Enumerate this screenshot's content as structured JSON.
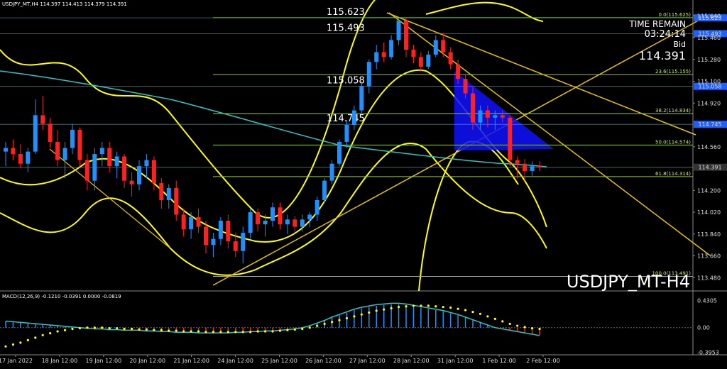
{
  "header": {
    "symbol_line": "USDJPY_MT,H4  114.397 114.413 114.379 114.391",
    "macd_line": "MACD(12,26,9) -0.1210 -0.0391 0.0000 -0.0819"
  },
  "info": {
    "time_remain_label": "TIME REMAIN",
    "time_remain_value": "03:24:14",
    "bid_label": "Bid",
    "bid_value": "114.391",
    "watermark": "USDJPY_MT-H4"
  },
  "colors": {
    "background": "#000000",
    "bull": "#1e90ff",
    "bear": "#ff2020",
    "bands": "#ffff00",
    "ma": "#2ec4c4",
    "fib": "#90c83c",
    "trend": "#e6c200",
    "triangle": "#1010ff",
    "macd_signal": "#ffff00"
  },
  "chart_data": {
    "type": "candlestick",
    "price_axis": {
      "ylim": [
        113.4,
        115.7
      ],
      "ticks": [
        "115.640",
        "115.460",
        "115.280",
        "115.100",
        "114.920",
        "114.560",
        "114.200",
        "114.020",
        "113.840",
        "113.660",
        "113.480"
      ]
    },
    "time_axis": {
      "ticks": [
        "17 Jan 2022",
        "18 Jan 12:00",
        "19 Jan 12:00",
        "20 Jan 12:00",
        "21 Jan 12:00",
        "24 Jan 12:00",
        "25 Jan 12:00",
        "26 Jan 12:00",
        "27 Jan 12:00",
        "28 Jan 12:00",
        "31 Jan 12:00",
        "1 Feb 12:00",
        "2 Feb 12:00"
      ]
    },
    "candles": [
      [
        114.52,
        114.6,
        114.4,
        114.55
      ],
      [
        114.55,
        114.62,
        114.45,
        114.5
      ],
      [
        114.5,
        114.58,
        114.38,
        114.42
      ],
      [
        114.42,
        114.55,
        114.35,
        114.52
      ],
      [
        114.52,
        114.95,
        114.5,
        114.82
      ],
      [
        114.82,
        114.98,
        114.7,
        114.75
      ],
      [
        114.75,
        114.8,
        114.55,
        114.6
      ],
      [
        114.6,
        114.7,
        114.4,
        114.45
      ],
      [
        114.45,
        114.6,
        114.3,
        114.55
      ],
      [
        114.55,
        114.75,
        114.5,
        114.7
      ],
      [
        114.7,
        114.72,
        114.4,
        114.45
      ],
      [
        114.45,
        114.5,
        114.2,
        114.28
      ],
      [
        114.28,
        114.55,
        114.2,
        114.5
      ],
      [
        114.5,
        114.6,
        114.4,
        114.55
      ],
      [
        114.55,
        114.6,
        114.35,
        114.4
      ],
      [
        114.4,
        114.52,
        114.3,
        114.48
      ],
      [
        114.48,
        114.5,
        114.22,
        114.28
      ],
      [
        114.28,
        114.35,
        114.15,
        114.25
      ],
      [
        114.25,
        114.45,
        114.2,
        114.4
      ],
      [
        114.4,
        114.5,
        114.3,
        114.45
      ],
      [
        114.45,
        114.48,
        114.2,
        114.26
      ],
      [
        114.26,
        114.3,
        114.05,
        114.12
      ],
      [
        114.12,
        114.25,
        114.05,
        114.22
      ],
      [
        114.22,
        114.28,
        113.95,
        114.0
      ],
      [
        114.0,
        114.05,
        113.82,
        113.88
      ],
      [
        113.88,
        114.02,
        113.8,
        113.98
      ],
      [
        113.98,
        114.05,
        113.85,
        113.9
      ],
      [
        113.9,
        113.95,
        113.68,
        113.75
      ],
      [
        113.75,
        113.85,
        113.65,
        113.8
      ],
      [
        113.8,
        113.98,
        113.75,
        113.95
      ],
      [
        113.95,
        114.0,
        113.72,
        113.78
      ],
      [
        113.78,
        113.85,
        113.65,
        113.7
      ],
      [
        113.7,
        113.9,
        113.6,
        113.85
      ],
      [
        113.85,
        114.05,
        113.8,
        114.02
      ],
      [
        114.02,
        114.05,
        113.86,
        113.92
      ],
      [
        113.92,
        114.0,
        113.82,
        113.95
      ],
      [
        113.95,
        114.1,
        113.9,
        114.06
      ],
      [
        114.06,
        114.1,
        113.88,
        113.92
      ],
      [
        113.92,
        114.0,
        113.84,
        113.96
      ],
      [
        113.96,
        113.99,
        113.86,
        113.9
      ],
      [
        113.9,
        114.0,
        113.86,
        113.96
      ],
      [
        113.96,
        114.02,
        113.9,
        114.0
      ],
      [
        114.0,
        114.15,
        113.95,
        114.12
      ],
      [
        114.12,
        114.3,
        114.1,
        114.28
      ],
      [
        114.28,
        114.45,
        114.25,
        114.42
      ],
      [
        114.42,
        114.62,
        114.4,
        114.6
      ],
      [
        114.6,
        114.78,
        114.55,
        114.74
      ],
      [
        114.74,
        114.9,
        114.7,
        114.86
      ],
      [
        114.86,
        115.1,
        114.84,
        115.06
      ],
      [
        115.06,
        115.28,
        115.0,
        115.26
      ],
      [
        115.26,
        115.4,
        115.2,
        115.34
      ],
      [
        115.34,
        115.42,
        115.26,
        115.3
      ],
      [
        115.3,
        115.48,
        115.28,
        115.44
      ],
      [
        115.44,
        115.62,
        115.4,
        115.6
      ],
      [
        115.6,
        115.63,
        115.3,
        115.36
      ],
      [
        115.36,
        115.4,
        115.25,
        115.3
      ],
      [
        115.3,
        115.34,
        115.18,
        115.22
      ],
      [
        115.22,
        115.35,
        115.2,
        115.32
      ],
      [
        115.32,
        115.48,
        115.3,
        115.44
      ],
      [
        115.44,
        115.5,
        115.3,
        115.34
      ],
      [
        115.34,
        115.38,
        115.2,
        115.24
      ],
      [
        115.24,
        115.28,
        115.08,
        115.12
      ],
      [
        115.12,
        115.16,
        114.96,
        115.0
      ],
      [
        115.0,
        115.05,
        114.7,
        114.76
      ],
      [
        114.76,
        114.9,
        114.7,
        114.86
      ],
      [
        114.86,
        114.9,
        114.72,
        114.8
      ],
      [
        114.8,
        114.86,
        114.7,
        114.82
      ],
      [
        114.82,
        114.86,
        114.76,
        114.8
      ],
      [
        114.8,
        114.82,
        114.4,
        114.45
      ],
      [
        114.45,
        114.48,
        114.3,
        114.42
      ],
      [
        114.42,
        114.46,
        114.28,
        114.36
      ],
      [
        114.36,
        114.44,
        114.32,
        114.4
      ],
      [
        114.4,
        114.44,
        114.36,
        114.39
      ]
    ],
    "fib_levels": [
      {
        "label": "0.0(115.625)",
        "value": 115.625
      },
      {
        "label": "23.6(115.155)",
        "value": 115.155
      },
      {
        "label": "38.2(114.834)",
        "value": 114.834
      },
      {
        "label": "50.0(114.574)",
        "value": 114.574
      },
      {
        "label": "61.8(114.314)",
        "value": 114.314
      },
      {
        "label": "100.0(113.491)",
        "value": 113.491
      }
    ],
    "price_levels": [
      {
        "label": "115.623",
        "value": 115.623
      },
      {
        "label": "115.493",
        "value": 115.493
      },
      {
        "label": "115.058",
        "value": 115.058
      },
      {
        "label": "114.745",
        "value": 114.745
      },
      {
        "label": "114.391",
        "value": 114.391
      }
    ],
    "macd_axis": {
      "ylim": [
        -0.4,
        0.45
      ],
      "ticks": [
        "0.4305",
        "0.00",
        "-0.3953"
      ]
    },
    "macd_histogram": [
      0.1,
      0.09,
      0.08,
      0.07,
      0.06,
      0.05,
      0.04,
      0.03,
      0.02,
      0.01,
      0.0,
      -0.01,
      -0.02,
      -0.02,
      -0.03,
      -0.03,
      -0.04,
      -0.04,
      -0.04,
      -0.05,
      -0.05,
      -0.06,
      -0.06,
      -0.07,
      -0.07,
      -0.07,
      -0.08,
      -0.08,
      -0.08,
      -0.08,
      -0.08,
      -0.07,
      -0.07,
      -0.06,
      -0.06,
      -0.05,
      -0.05,
      -0.04,
      -0.03,
      -0.02,
      0.0,
      0.03,
      0.07,
      0.11,
      0.16,
      0.2,
      0.24,
      0.28,
      0.31,
      0.33,
      0.35,
      0.36,
      0.37,
      0.37,
      0.36,
      0.34,
      0.32,
      0.3,
      0.28,
      0.26,
      0.23,
      0.2,
      0.16,
      0.12,
      0.08,
      0.04,
      0.0,
      -0.02,
      -0.04,
      -0.06,
      -0.08,
      -0.1,
      -0.12
    ],
    "macd_signal": [
      -0.3,
      -0.27,
      -0.24,
      -0.2,
      -0.16,
      -0.12,
      -0.09,
      -0.06,
      -0.04,
      -0.02,
      -0.01,
      0.0,
      0.0,
      0.0,
      -0.01,
      -0.01,
      -0.02,
      -0.02,
      -0.03,
      -0.03,
      -0.04,
      -0.04,
      -0.05,
      -0.05,
      -0.06,
      -0.06,
      -0.06,
      -0.07,
      -0.07,
      -0.07,
      -0.07,
      -0.07,
      -0.07,
      -0.07,
      -0.06,
      -0.06,
      -0.06,
      -0.05,
      -0.04,
      -0.03,
      -0.02,
      0.0,
      0.03,
      0.06,
      0.09,
      0.12,
      0.15,
      0.18,
      0.21,
      0.24,
      0.27,
      0.29,
      0.31,
      0.33,
      0.34,
      0.35,
      0.35,
      0.35,
      0.34,
      0.33,
      0.32,
      0.3,
      0.28,
      0.25,
      0.22,
      0.18,
      0.14,
      0.1,
      0.06,
      0.03,
      0.01,
      -0.01,
      -0.02
    ]
  }
}
